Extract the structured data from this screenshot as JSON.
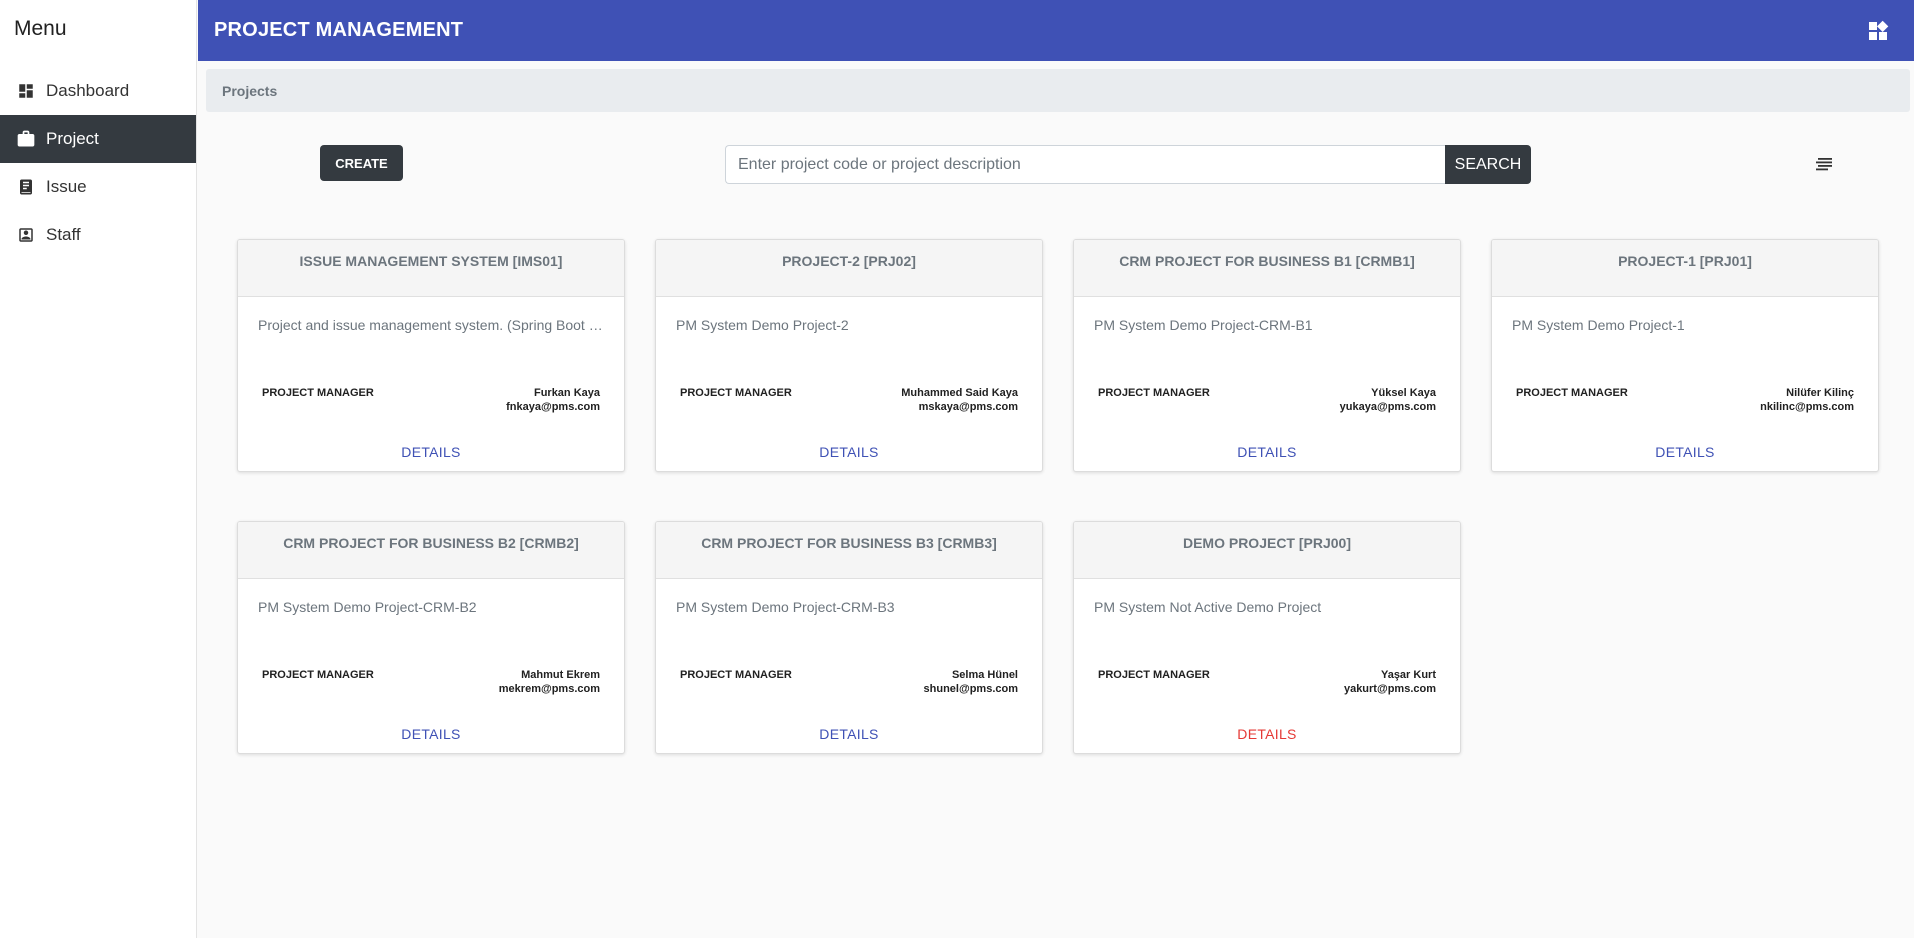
{
  "sidebar": {
    "title": "Menu",
    "items": [
      {
        "label": "Dashboard",
        "icon": "dashboard-icon"
      },
      {
        "label": "Project",
        "icon": "briefcase-icon",
        "active": true
      },
      {
        "label": "Issue",
        "icon": "book-icon"
      },
      {
        "label": "Staff",
        "icon": "contact-icon"
      }
    ]
  },
  "header": {
    "title": "PROJECT MANAGEMENT",
    "icon": "widgets-icon",
    "color": "#3f51b5"
  },
  "breadcrumb": {
    "label": "Projects"
  },
  "toolbar": {
    "create_label": "CREATE",
    "search_placeholder": "Enter project code or project description",
    "search_value": "",
    "search_label": "SEARCH",
    "sort_icon": "sort-icon"
  },
  "projects": [
    {
      "title": "ISSUE MANAGEMENT SYSTEM [IMS01]",
      "description": "Project and issue management system. (Spring Boot - Angular)",
      "pm_label": "PROJECT MANAGER",
      "pm_name": "Furkan Kaya",
      "pm_email": "fnkaya@pms.com",
      "details_label": "DETAILS",
      "active": true
    },
    {
      "title": "PROJECT-2 [PRJ02]",
      "description": "PM System Demo Project-2",
      "pm_label": "PROJECT MANAGER",
      "pm_name": "Muhammed Said Kaya",
      "pm_email": "mskaya@pms.com",
      "details_label": "DETAILS",
      "active": true
    },
    {
      "title": "CRM PROJECT FOR BUSINESS B1 [CRMB1]",
      "description": "PM System Demo Project-CRM-B1",
      "pm_label": "PROJECT MANAGER",
      "pm_name": "Yüksel Kaya",
      "pm_email": "yukaya@pms.com",
      "details_label": "DETAILS",
      "active": true
    },
    {
      "title": "PROJECT-1 [PRJ01]",
      "description": "PM System Demo Project-1",
      "pm_label": "PROJECT MANAGER",
      "pm_name": "Nilüfer Kilinç",
      "pm_email": "nkilinc@pms.com",
      "details_label": "DETAILS",
      "active": true
    },
    {
      "title": "CRM PROJECT FOR BUSINESS B2 [CRMB2]",
      "description": "PM System Demo Project-CRM-B2",
      "pm_label": "PROJECT MANAGER",
      "pm_name": "Mahmut Ekrem",
      "pm_email": "mekrem@pms.com",
      "details_label": "DETAILS",
      "active": true
    },
    {
      "title": "CRM PROJECT FOR BUSINESS B3 [CRMB3]",
      "description": "PM System Demo Project-CRM-B3",
      "pm_label": "PROJECT MANAGER",
      "pm_name": "Selma Hünel",
      "pm_email": "shunel@pms.com",
      "details_label": "DETAILS",
      "active": true
    },
    {
      "title": "DEMO PROJECT [PRJ00]",
      "description": "PM System Not Active Demo Project",
      "pm_label": "PROJECT MANAGER",
      "pm_name": "Yaşar Kurt",
      "pm_email": "yakurt@pms.com",
      "details_label": "DETAILS",
      "active": false
    }
  ],
  "colors": {
    "accent": "#3f51b5",
    "dark": "#343a40",
    "inactive": "#e53935"
  }
}
